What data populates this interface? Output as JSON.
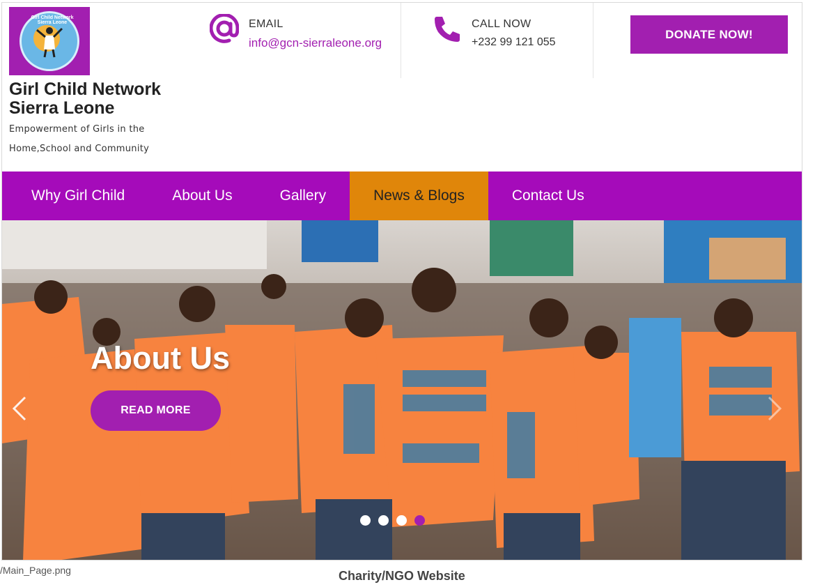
{
  "colors": {
    "brand_purple": "#a21fb0",
    "nav_purple": "#a50bba",
    "active_orange": "#e0860a"
  },
  "logo": {
    "arc_text": "Girl Child Network Sierra Leone"
  },
  "site": {
    "title_line1": "Girl Child Network",
    "title_line2": "Sierra Leone",
    "tagline": "Empowerment of Girls in the Home,School and Community"
  },
  "contact": {
    "email_label": "EMAIL",
    "email_value": "info@gcn-sierraleone.org",
    "email_icon": "at-icon",
    "call_label": "CALL NOW",
    "call_value": "+232 99 121 055",
    "call_icon": "phone-icon"
  },
  "donate_label": "DONATE NOW!",
  "nav": {
    "items": [
      {
        "label": "Why Girl Child",
        "active": false
      },
      {
        "label": "About Us",
        "active": false
      },
      {
        "label": "Gallery",
        "active": false
      },
      {
        "label": "News & Blogs",
        "active": true
      },
      {
        "label": "Contact Us",
        "active": false
      }
    ]
  },
  "slider": {
    "title": "About Us",
    "button_label": "READ MORE",
    "prev_icon": "chevron-left-icon",
    "next_icon": "chevron-right-icon",
    "slide_count": 4,
    "active_slide": 4
  },
  "caption": {
    "file": "/Main_Page.png",
    "title": "Charity/NGO Website"
  }
}
